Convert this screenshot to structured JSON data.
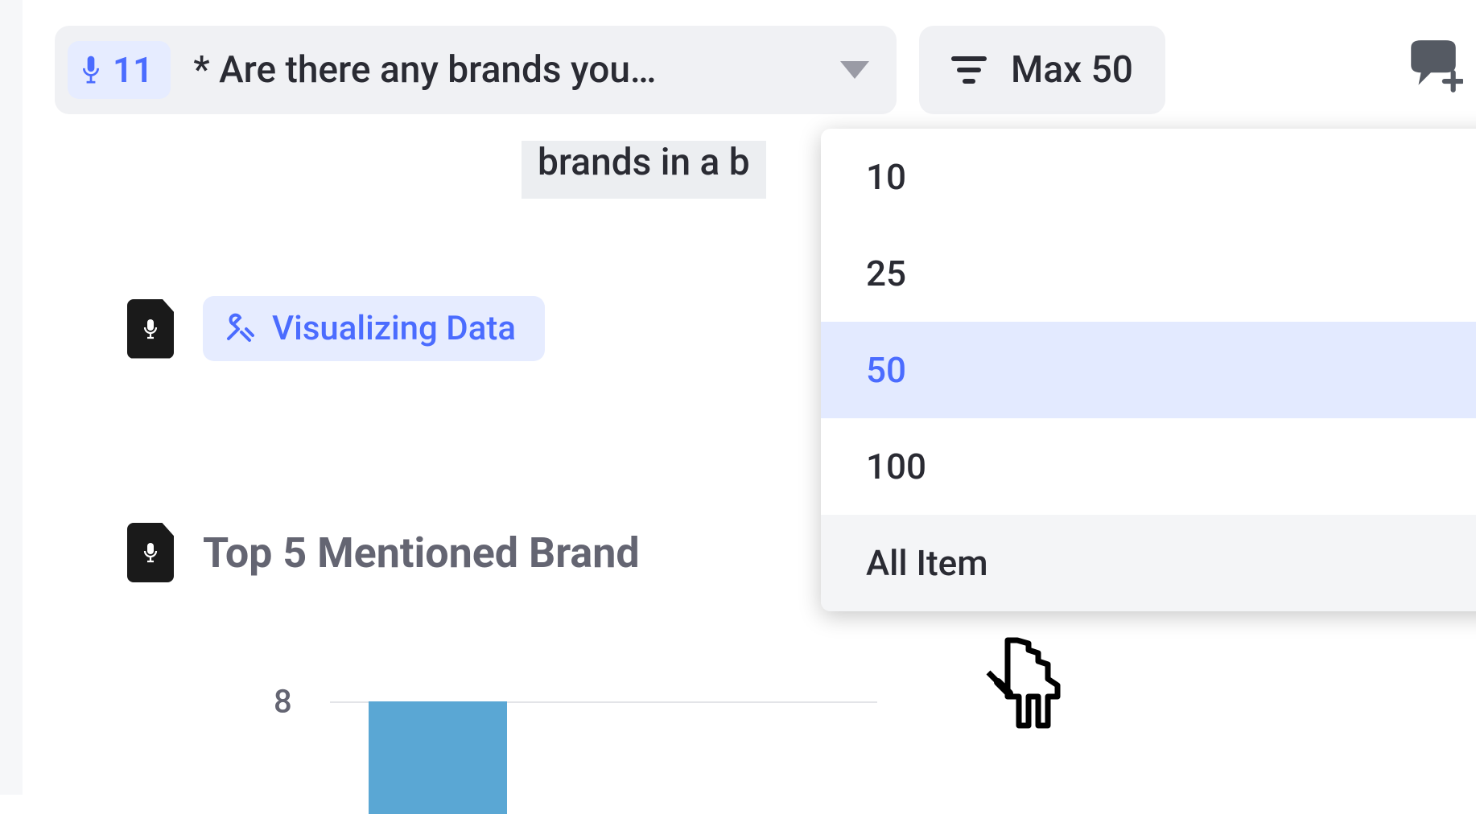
{
  "toolbar": {
    "mic_count": "11",
    "question_text": "* Are there any brands you…",
    "max_label": "Max 50"
  },
  "partial_text": "brands in a b",
  "viz_badge_label": "Visualizing Data",
  "chart_title": "Top 5 Mentioned Brand",
  "dropdown": {
    "items": [
      {
        "label": "10",
        "state": ""
      },
      {
        "label": "25",
        "state": ""
      },
      {
        "label": "50",
        "state": "selected"
      },
      {
        "label": "100",
        "state": ""
      },
      {
        "label": "All Item",
        "state": "hover"
      }
    ]
  },
  "chart_data": {
    "type": "bar",
    "title": "Top 5 Mentioned Brand",
    "visible_ticks": [
      "8"
    ],
    "note": "only top of first bar visible; values not readable beyond y-tick 8"
  }
}
